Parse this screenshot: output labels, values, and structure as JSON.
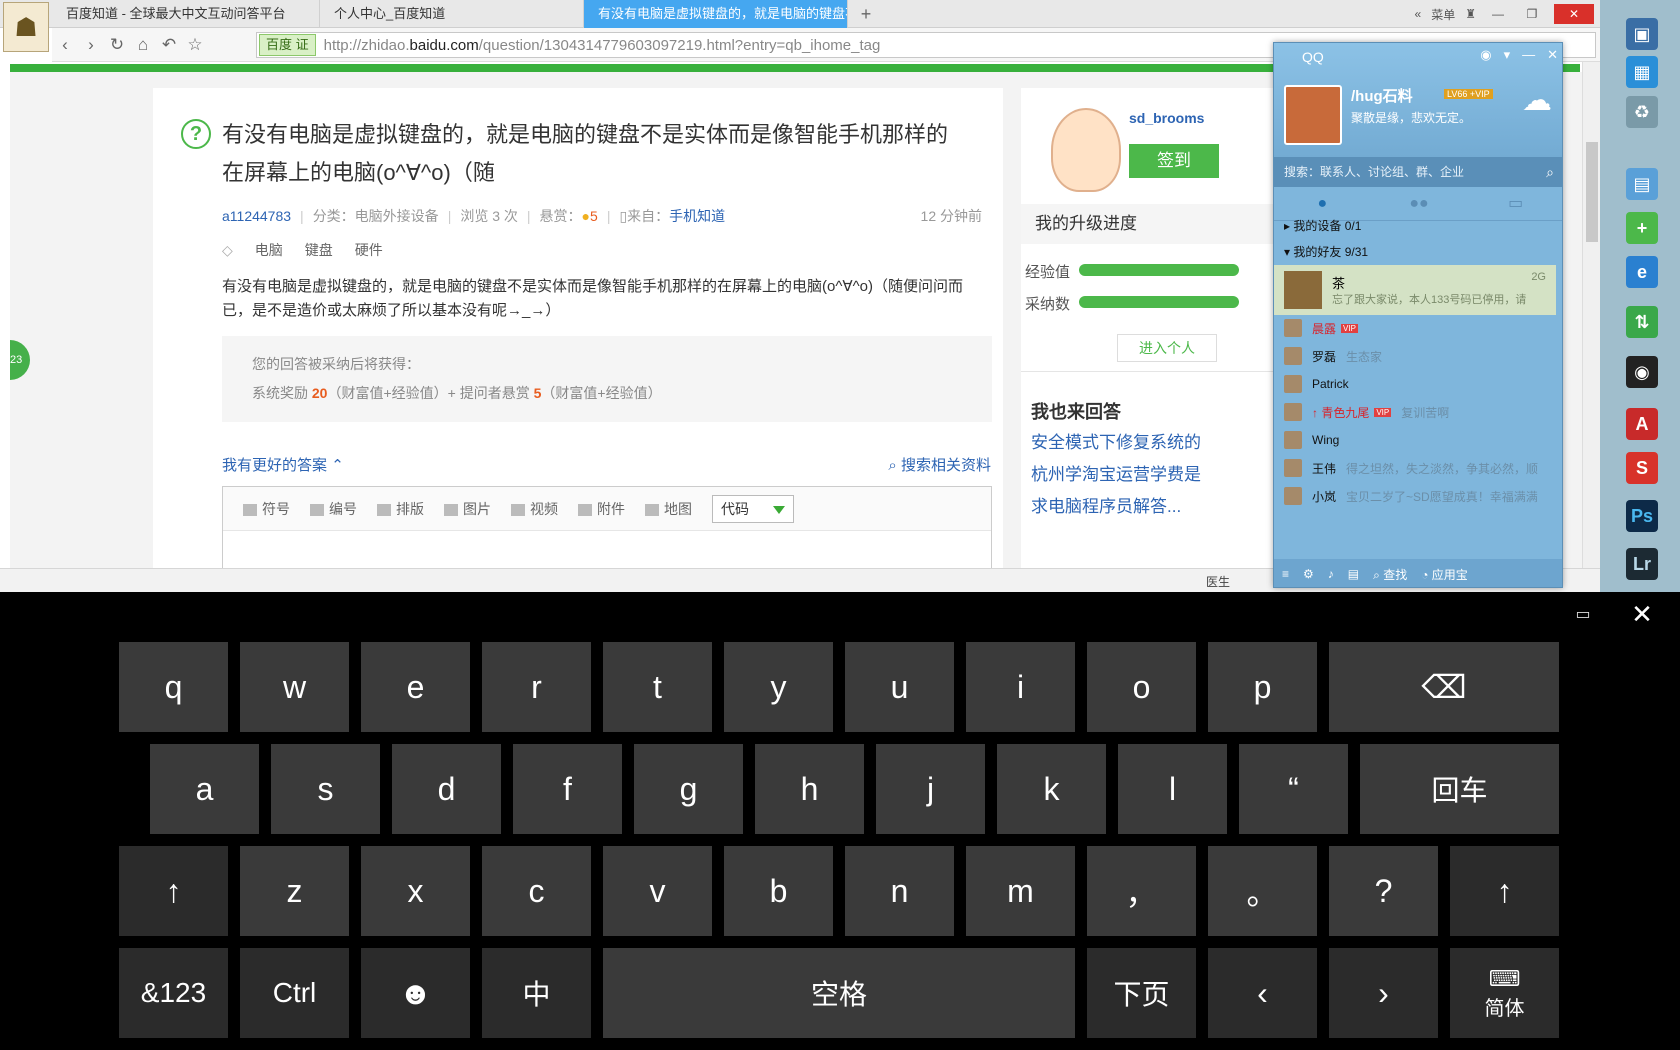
{
  "browser": {
    "tabs": [
      {
        "label": "百度知道 - 全球最大中文互动问答平台"
      },
      {
        "label": "个人中心_百度知道"
      },
      {
        "label": "有没有电脑是虚拟键盘的，就是电脑的键盘不"
      }
    ],
    "menu_label": "菜单",
    "address_badge": "百度 证",
    "url_prefix": "http://zhidao.",
    "url_domain": "baidu.com",
    "url_suffix": "/question/1304314779603097219.html?entry=qb_ihome_tag"
  },
  "question": {
    "title": "有没有电脑是虚拟键盘的，就是电脑的键盘不是实体而是像智能手机那样的在屏幕上的电脑(o^∀^o)（随",
    "author": "a11244783",
    "category": "分类：电脑外接设备",
    "views": "浏览 3 次",
    "reward_label": "悬赏：",
    "reward_value": "5",
    "source_label": "来自：",
    "source": "手机知道",
    "time": "12 分钟前",
    "tags": [
      "电脑",
      "键盘",
      "硬件"
    ],
    "body": "有没有电脑是虚拟键盘的，就是电脑的键盘不是实体而是像智能手机那样的在屏幕上的电脑(o^∀^o)（随便问问而已，是不是造价或太麻烦了所以基本没有呢→_→）",
    "reward_box": {
      "line1": "您的回答被采纳后将获得：",
      "line2_a": "系统奖励 ",
      "line2_n1": "20",
      "line2_b": "（财富值+经验值）+ 提问者悬赏 ",
      "line2_n2": "5",
      "line2_c": "（财富值+经验值）"
    },
    "better_answer": "我有更好的答案",
    "search_related": "搜索相关资料",
    "editor_tools": [
      "符号",
      "编号",
      "排版",
      "图片",
      "视频",
      "附件",
      "地图"
    ],
    "code_select": "代码"
  },
  "sidebar": {
    "username": "sd_brooms",
    "signin": "签到",
    "upgrade": "我的升级进度",
    "exp_label": "经验值",
    "adopt_label": "采纳数",
    "enter": "进入个人",
    "answer_title": "我也来回答",
    "answer_links": [
      "安全模式下修复系统的",
      "杭州学淘宝运营学费是",
      "求电脑程序员解答..."
    ]
  },
  "status": {
    "doctor": "医生",
    "badge": "23"
  },
  "qq": {
    "title": "QQ",
    "nick": "/hug石料",
    "level": "LV66 +VIP",
    "signature": "聚散是缘，悲欢无定。",
    "search_placeholder": "搜索：联系人、讨论组、群、企业",
    "group_devices": "我的设备 0/1",
    "group_friends": "我的好友 9/31",
    "highlight": {
      "name": "茶",
      "sig": "忘了跟大家说，本人133号码已停用，请",
      "net": "2G"
    },
    "friends": [
      {
        "name": "晨露",
        "sig": "",
        "vip": "VIP"
      },
      {
        "name": "罗磊",
        "sig": "生态家",
        "vip": ""
      },
      {
        "name": "Patrick",
        "sig": "",
        "vip": ""
      },
      {
        "name": "↑ 青色九尾",
        "sig": "复训苦啊",
        "vip": "VIP"
      },
      {
        "name": "Wing",
        "sig": "",
        "vip": ""
      },
      {
        "name": "王伟",
        "sig": "得之坦然，失之淡然，争其必然，顺",
        "vip": ""
      },
      {
        "name": "小岚",
        "sig": "宝贝二岁了~SD愿望成真！幸福满满",
        "vip": ""
      }
    ],
    "find": "查找",
    "app": "应用宝"
  },
  "keyboard": {
    "row1": [
      "q",
      "w",
      "e",
      "r",
      "t",
      "y",
      "u",
      "i",
      "o",
      "p"
    ],
    "row2": [
      "a",
      "s",
      "d",
      "f",
      "g",
      "h",
      "j",
      "k",
      "l",
      "“"
    ],
    "enter": "回车",
    "row3": [
      "z",
      "x",
      "c",
      "v",
      "b",
      "n",
      "m",
      "，",
      "。",
      "?"
    ],
    "shift": "↑",
    "sym": "&123",
    "ctrl": "Ctrl",
    "emoji": "☻",
    "ime": "中",
    "space": "空格",
    "next": "下页",
    "left": "‹",
    "right": "›",
    "simplified": "简体",
    "backspace": "⌫"
  }
}
